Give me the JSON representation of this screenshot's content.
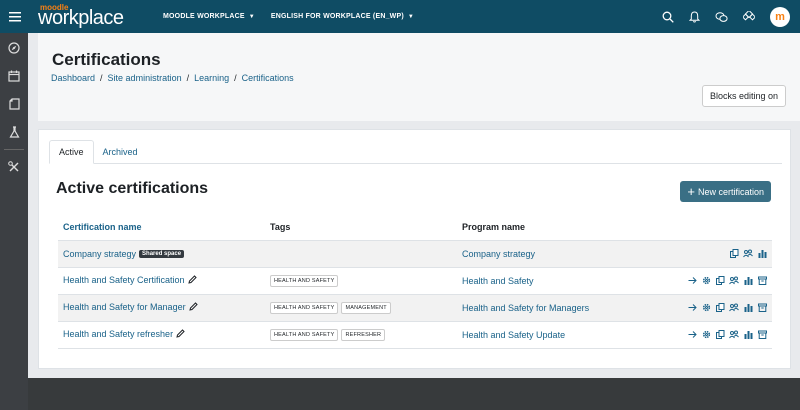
{
  "navbar": {
    "logo_small": "moodle",
    "logo_big": "workplace",
    "menu": [
      {
        "label": "MOODLE WORKPLACE"
      },
      {
        "label": "ENGLISH FOR WORKPLACE (EN_WP)"
      }
    ],
    "avatar_letter": "m",
    "icons": [
      "search-icon",
      "bell-icon",
      "messages-icon",
      "apps-icon"
    ]
  },
  "drawer": {
    "items": [
      "compass-icon",
      "calendar-icon",
      "file-icon",
      "flask-icon",
      "tools-icon"
    ]
  },
  "page_header": {
    "title": "Certifications",
    "breadcrumb": [
      {
        "label": "Dashboard"
      },
      {
        "label": "Site administration"
      },
      {
        "label": "Learning"
      },
      {
        "label": "Certifications"
      }
    ],
    "blocks_editing_label": "Blocks editing on"
  },
  "tabs": [
    {
      "label": "Active"
    },
    {
      "label": "Archived"
    }
  ],
  "section": {
    "title": "Active certifications",
    "new_button_label": "New certification"
  },
  "table": {
    "columns": {
      "name": "Certification name",
      "tags": "Tags",
      "program": "Program name"
    },
    "rows": [
      {
        "name": "Company strategy",
        "badge": "Shared space",
        "tags": [],
        "program": "Company strategy"
      },
      {
        "name": "Health and Safety Certification",
        "tags": [
          "HEALTH AND SAFETY"
        ],
        "program": "Health and Safety"
      },
      {
        "name": "Health and Safety for Manager",
        "tags": [
          "HEALTH AND SAFETY",
          "MANAGEMENT"
        ],
        "program": "Health and Safety for Managers"
      },
      {
        "name": "Health and Safety refresher",
        "tags": [
          "HEALTH AND SAFETY",
          "REFRESHER"
        ],
        "program": "Health and Safety Update"
      }
    ]
  },
  "colors": {
    "navbar": "#0f4c64",
    "accent": "#f98012",
    "link": "#1a6289",
    "primary_button": "#3a6f85"
  }
}
